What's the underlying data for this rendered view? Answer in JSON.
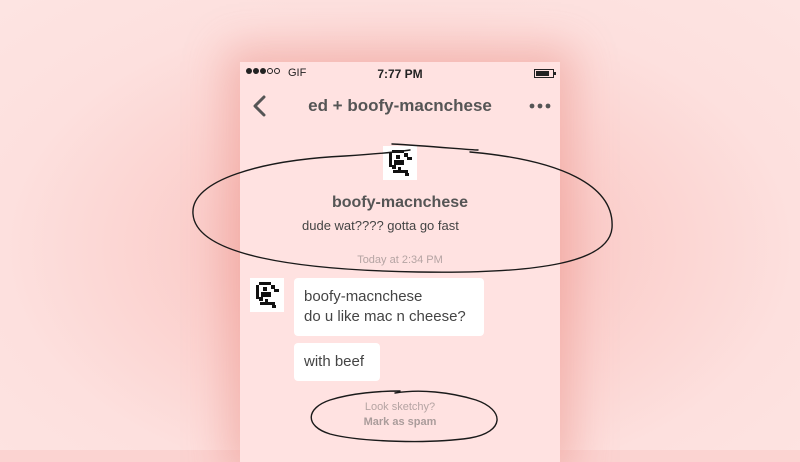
{
  "status_bar": {
    "carrier": "GIF",
    "time": "7:77 PM",
    "signal_dots_filled": 3,
    "signal_dots_total": 5
  },
  "header": {
    "title": "ed + boofy-macnchese",
    "back_icon": "chevron-left-icon",
    "more_icon": "ellipsis-icon"
  },
  "profile": {
    "name": "boofy-macnchese",
    "bio": "dude wat???? gotta go fast"
  },
  "conversation": {
    "timestamp": "Today at 2:34 PM",
    "messages": [
      {
        "sender": "boofy-macnchese",
        "text": "do u like mac n cheese?"
      },
      {
        "text": "with beef"
      }
    ]
  },
  "spam_prompt": {
    "question": "Look sketchy?",
    "action": "Mark as spam"
  },
  "colors": {
    "page_background": "#fbd3d1",
    "phone_background": "#ffe2e1",
    "bubble": "#ffffff",
    "header_text": "#555555",
    "muted_text": "#b5a4a3",
    "annotation_ink": "#1a1a1a"
  }
}
